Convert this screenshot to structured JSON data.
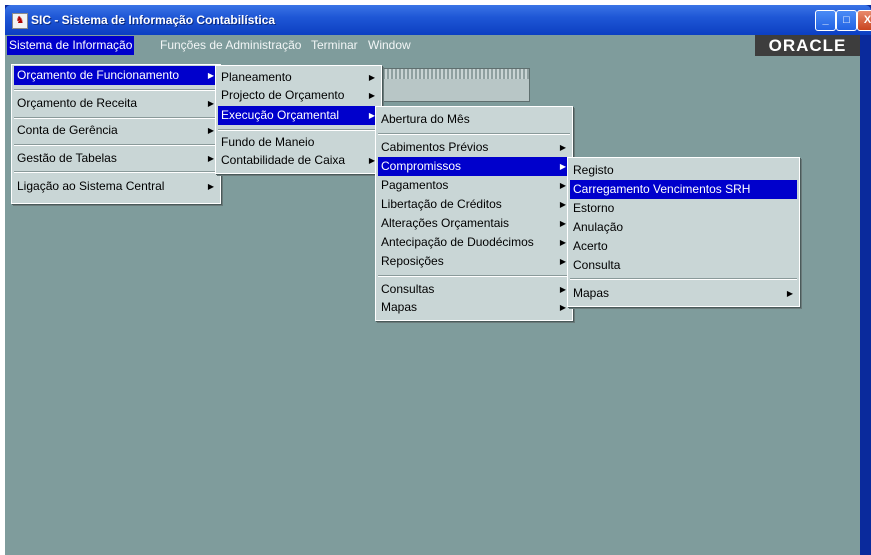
{
  "window": {
    "title": "SIC - Sistema de Informação Contabilística",
    "minimize": "_",
    "maximize": "□",
    "close": "X"
  },
  "menubar": {
    "items": [
      "Sistema de Informação",
      "Funções de Administração",
      "Terminar",
      "Window"
    ],
    "logo": "ORACLE"
  },
  "menu1": [
    "Orçamento de Funcionamento",
    "Orçamento de Receita",
    "Conta de Gerência",
    "Gestão de Tabelas",
    "Ligação ao Sistema Central"
  ],
  "menu2": [
    "Planeamento",
    "Projecto de Orçamento",
    "Execução Orçamental",
    "Fundo de Maneio",
    "Contabilidade de Caixa"
  ],
  "menu3": [
    "Abertura do Mês",
    "Cabimentos Prévios",
    "Compromissos",
    "Pagamentos",
    "Libertação de Créditos",
    "Alterações Orçamentais",
    "Antecipação de Duodécimos",
    "Reposições",
    "Consultas",
    "Mapas"
  ],
  "menu4": [
    "Registo",
    "Carregamento Vencimentos  SRH",
    "Estorno",
    "Anulação",
    "Acerto",
    "Consulta",
    "Mapas"
  ],
  "colors": {
    "selection": "#0000cc",
    "workspace": "#7f9c9c",
    "menu_bg": "#c9d6d6"
  }
}
